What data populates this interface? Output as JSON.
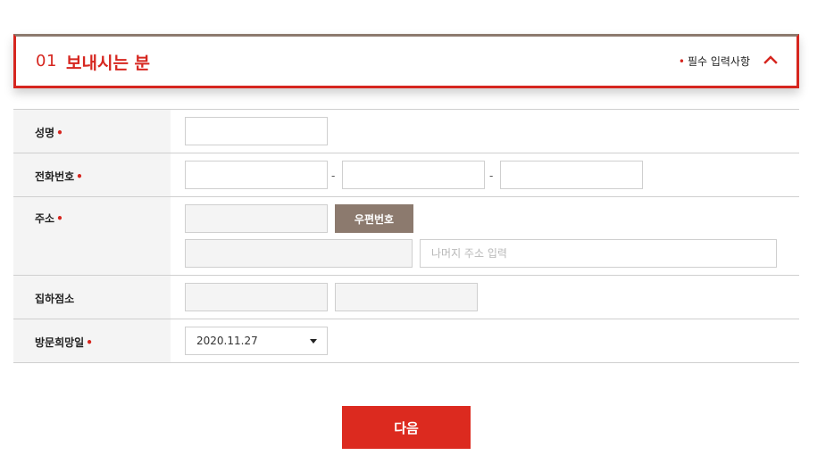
{
  "section": {
    "number": "01",
    "title": "보내시는 분",
    "required_marker": "•",
    "required_note": "필수 입력사항",
    "toggle_icon": "chevron-up-icon",
    "accent_color": "#d6261f",
    "border_top_color": "#8c7a6e"
  },
  "form": {
    "rows": {
      "name": {
        "label": "성명",
        "required": "•"
      },
      "phone": {
        "label": "전화번호",
        "required": "•",
        "separator": "-"
      },
      "address": {
        "label": "주소",
        "required": "•",
        "postcode_button": "우편번호",
        "detail_placeholder": "나머지 주소 입력"
      },
      "pickup": {
        "label": "집하점소"
      },
      "visit_date": {
        "label": "방문희망일",
        "required": "•",
        "selected_value": "2020.11.27"
      }
    }
  },
  "actions": {
    "next_label": "다음",
    "next_color": "#dc2a1f",
    "postcode_color": "#8c7a6e"
  }
}
